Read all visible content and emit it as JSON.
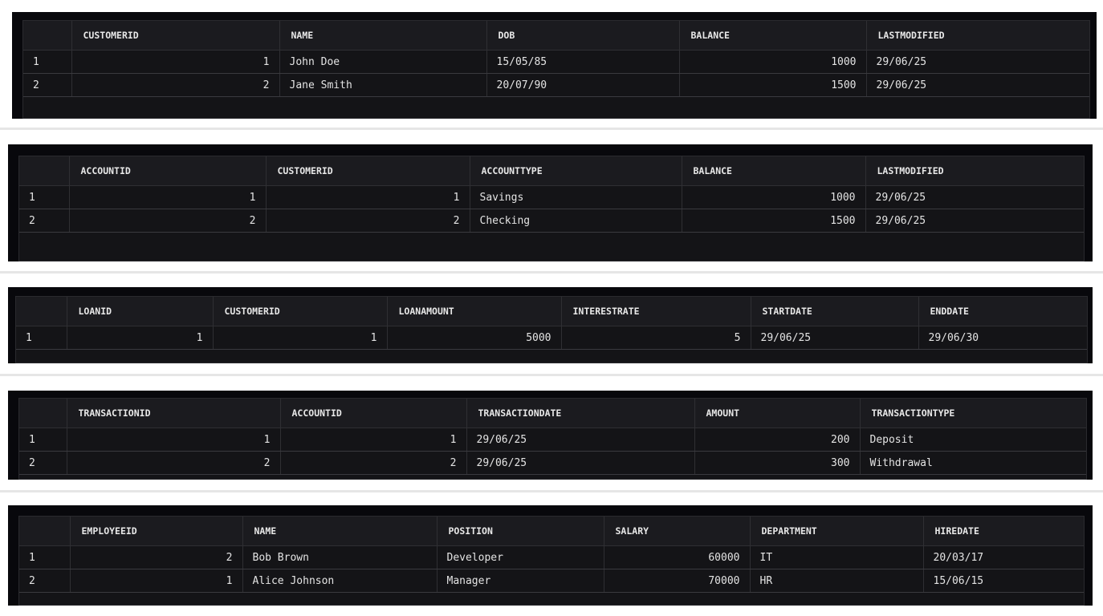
{
  "tables": [
    {
      "columns": [
        "",
        "CUSTOMERID",
        "NAME",
        "DOB",
        "BALANCE",
        "LASTMODIFIED"
      ],
      "rows": [
        [
          "1",
          "1",
          "John Doe",
          "15/05/85",
          "1000",
          "29/06/25"
        ],
        [
          "2",
          "2",
          "Jane Smith",
          "20/07/90",
          "1500",
          "29/06/25"
        ]
      ]
    },
    {
      "columns": [
        "",
        "ACCOUNTID",
        "CUSTOMERID",
        "ACCOUNTTYPE",
        "BALANCE",
        "LASTMODIFIED"
      ],
      "rows": [
        [
          "1",
          "1",
          "1",
          "Savings",
          "1000",
          "29/06/25"
        ],
        [
          "2",
          "2",
          "2",
          "Checking",
          "1500",
          "29/06/25"
        ]
      ]
    },
    {
      "columns": [
        "",
        "LOANID",
        "CUSTOMERID",
        "LOANAMOUNT",
        "INTERESTRATE",
        "STARTDATE",
        "ENDDATE"
      ],
      "rows": [
        [
          "1",
          "1",
          "1",
          "5000",
          "5",
          "29/06/25",
          "29/06/30"
        ]
      ]
    },
    {
      "columns": [
        "",
        "TRANSACTIONID",
        "ACCOUNTID",
        "TRANSACTIONDATE",
        "AMOUNT",
        "TRANSACTIONTYPE"
      ],
      "rows": [
        [
          "1",
          "1",
          "1",
          "29/06/25",
          "200",
          "Deposit"
        ],
        [
          "2",
          "2",
          "2",
          "29/06/25",
          "300",
          "Withdrawal"
        ]
      ]
    },
    {
      "columns": [
        "",
        "EMPLOYEEID",
        "NAME",
        "POSITION",
        "SALARY",
        "DEPARTMENT",
        "HIREDATE"
      ],
      "rows": [
        [
          "1",
          "2",
          "Bob Brown",
          "Developer",
          "60000",
          "IT",
          "20/03/17"
        ],
        [
          "2",
          "1",
          "Alice Johnson",
          "Manager",
          "70000",
          "HR",
          "15/06/15"
        ]
      ]
    }
  ]
}
